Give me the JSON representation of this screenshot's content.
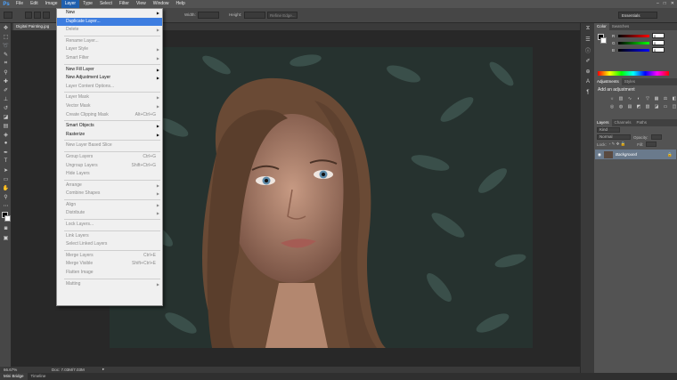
{
  "app": {
    "logo": "Ps"
  },
  "menubar": [
    "File",
    "Edit",
    "Image",
    "Layer",
    "Type",
    "Select",
    "Filter",
    "View",
    "Window",
    "Help"
  ],
  "options_bar": {
    "width_label": "Width:",
    "height_label": "Height:",
    "refine_label": "Refine Edge...",
    "workspace": "Essentials"
  },
  "document": {
    "tab_title": "Digital Painting.jpg",
    "zoom": "66.67%",
    "doc_info": "Doc: 7.03M/7.03M"
  },
  "layer_menu": [
    {
      "label": "New",
      "arrow": true
    },
    {
      "label": "Duplicate Layer...",
      "highlight": true
    },
    {
      "label": "Delete",
      "arrow": true,
      "disabled": true
    },
    {
      "sep": true
    },
    {
      "label": "Rename Layer...",
      "disabled": true
    },
    {
      "label": "Layer Style",
      "arrow": true,
      "disabled": true
    },
    {
      "label": "Smart Filter",
      "arrow": true,
      "disabled": true
    },
    {
      "sep": true
    },
    {
      "label": "New Fill Layer",
      "arrow": true
    },
    {
      "label": "New Adjustment Layer",
      "arrow": true
    },
    {
      "label": "Layer Content Options...",
      "disabled": true
    },
    {
      "sep": true
    },
    {
      "label": "Layer Mask",
      "arrow": true,
      "disabled": true
    },
    {
      "label": "Vector Mask",
      "arrow": true,
      "disabled": true
    },
    {
      "label": "Create Clipping Mask",
      "shortcut": "Alt+Ctrl+G",
      "disabled": true
    },
    {
      "sep": true
    },
    {
      "label": "Smart Objects",
      "arrow": true
    },
    {
      "label": "Rasterize",
      "arrow": true
    },
    {
      "sep": true
    },
    {
      "label": "New Layer Based Slice",
      "disabled": true
    },
    {
      "sep": true
    },
    {
      "label": "Group Layers",
      "shortcut": "Ctrl+G",
      "disabled": true
    },
    {
      "label": "Ungroup Layers",
      "shortcut": "Shift+Ctrl+G",
      "disabled": true
    },
    {
      "label": "Hide Layers",
      "disabled": true
    },
    {
      "sep": true
    },
    {
      "label": "Arrange",
      "arrow": true,
      "disabled": true
    },
    {
      "label": "Combine Shapes",
      "arrow": true,
      "disabled": true
    },
    {
      "sep": true
    },
    {
      "label": "Align",
      "arrow": true,
      "disabled": true
    },
    {
      "label": "Distribute",
      "arrow": true,
      "disabled": true
    },
    {
      "sep": true
    },
    {
      "label": "Lock Layers...",
      "disabled": true
    },
    {
      "sep": true
    },
    {
      "label": "Link Layers",
      "disabled": true
    },
    {
      "label": "Select Linked Layers",
      "disabled": true
    },
    {
      "sep": true
    },
    {
      "label": "Merge Layers",
      "shortcut": "Ctrl+E",
      "disabled": true
    },
    {
      "label": "Merge Visible",
      "shortcut": "Shift+Ctrl+E",
      "disabled": true
    },
    {
      "label": "Flatten Image",
      "disabled": true
    },
    {
      "sep": true
    },
    {
      "label": "Matting",
      "arrow": true,
      "disabled": true
    }
  ],
  "color_panel": {
    "tabs": [
      "Color",
      "Swatches"
    ],
    "channels": [
      {
        "name": "R",
        "value": "0"
      },
      {
        "name": "G",
        "value": "0"
      },
      {
        "name": "B",
        "value": "0"
      }
    ]
  },
  "adjustments_panel": {
    "tabs": [
      "Adjustments",
      "Styles"
    ],
    "title": "Add an adjustment"
  },
  "layers_panel": {
    "tabs": [
      "Layers",
      "Channels",
      "Paths"
    ],
    "kind": "Kind",
    "blend": "Normal",
    "opacity_label": "Opacity:",
    "lock_label": "Lock:",
    "fill_label": "Fill:",
    "layer_name": "Background"
  },
  "bottom_tabs": [
    "Mini Bridge",
    "Timeline"
  ],
  "colors": {
    "menu_highlight": "#3d7de0",
    "accent": "#4da3ff"
  }
}
